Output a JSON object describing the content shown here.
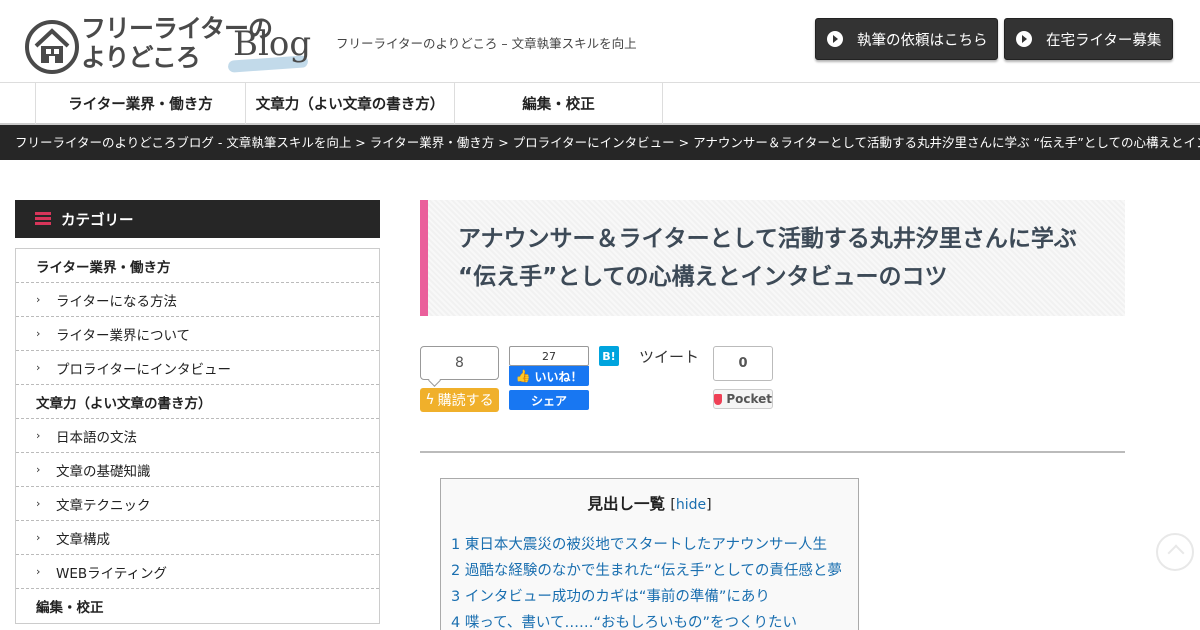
{
  "header": {
    "logo_line1": "フリーライターの",
    "logo_line2": "よりどころ",
    "logo_blog": "Blog",
    "tagline": "フリーライターのよりどころ – 文章執筆スキルを向上",
    "buttons": [
      {
        "label": "執筆の依頼はこちら"
      },
      {
        "label": "在宅ライター募集"
      }
    ]
  },
  "nav": {
    "items": [
      {
        "label": "ライター業界・働き方"
      },
      {
        "label": "文章力（よい文章の書き方）"
      },
      {
        "label": "編集・校正"
      }
    ]
  },
  "breadcrumb": "フリーライターのよりどころブログ - 文章執筆スキルを向上 > ライター業界・働き方 > プロライターにインタビュー > アナウンサー＆ライターとして活動する丸井汐里さんに学ぶ “伝え手”としての心構えとインタビュ",
  "sidebar": {
    "heading": "カテゴリー",
    "items": [
      {
        "label": "ライター業界・働き方"
      },
      {
        "label": "ライターになる方法"
      },
      {
        "label": "ライター業界について"
      },
      {
        "label": "プロライターにインタビュー"
      },
      {
        "label": "文章力（よい文章の書き方）"
      },
      {
        "label": "日本語の文法"
      },
      {
        "label": "文章の基礎知識"
      },
      {
        "label": "文章テクニック"
      },
      {
        "label": "文章構成"
      },
      {
        "label": "WEBライティング"
      },
      {
        "label": "編集・校正"
      }
    ]
  },
  "article": {
    "title": "アナウンサー＆ライターとして活動する丸井汐里さんに学ぶ “伝え手”としての心構えとインタビューのコツ"
  },
  "share": {
    "feedly_count": "8",
    "feedly_label": "購読する",
    "fb_count": "27",
    "fb_like": "いいね！",
    "fb_share": "シェア",
    "hatena_label": "B!",
    "tweet_label": "ツイート",
    "pocket_count": "0",
    "pocket_label": "Pocket"
  },
  "toc": {
    "title": "見出し一覧",
    "hide_label": "hide",
    "items": [
      {
        "label": "1 東日本大震災の被災地でスタートしたアナウンサー人生"
      },
      {
        "label": "2 過酷な経験のなかで生まれた“伝え手”としての責任感と夢"
      },
      {
        "label": "3 インタビュー成功のカギは“事前の準備”にあり"
      },
      {
        "label": "4 喋って、書いて……“おもしろいもの”をつくりたい"
      }
    ]
  },
  "colors": {
    "accent_pink": "#ea5f9b",
    "dark": "#262626",
    "link": "#1a6fb0",
    "feedly": "#f0b02b",
    "facebook": "#1877f2",
    "hatena": "#00a4de",
    "pocket": "#ef4056"
  }
}
